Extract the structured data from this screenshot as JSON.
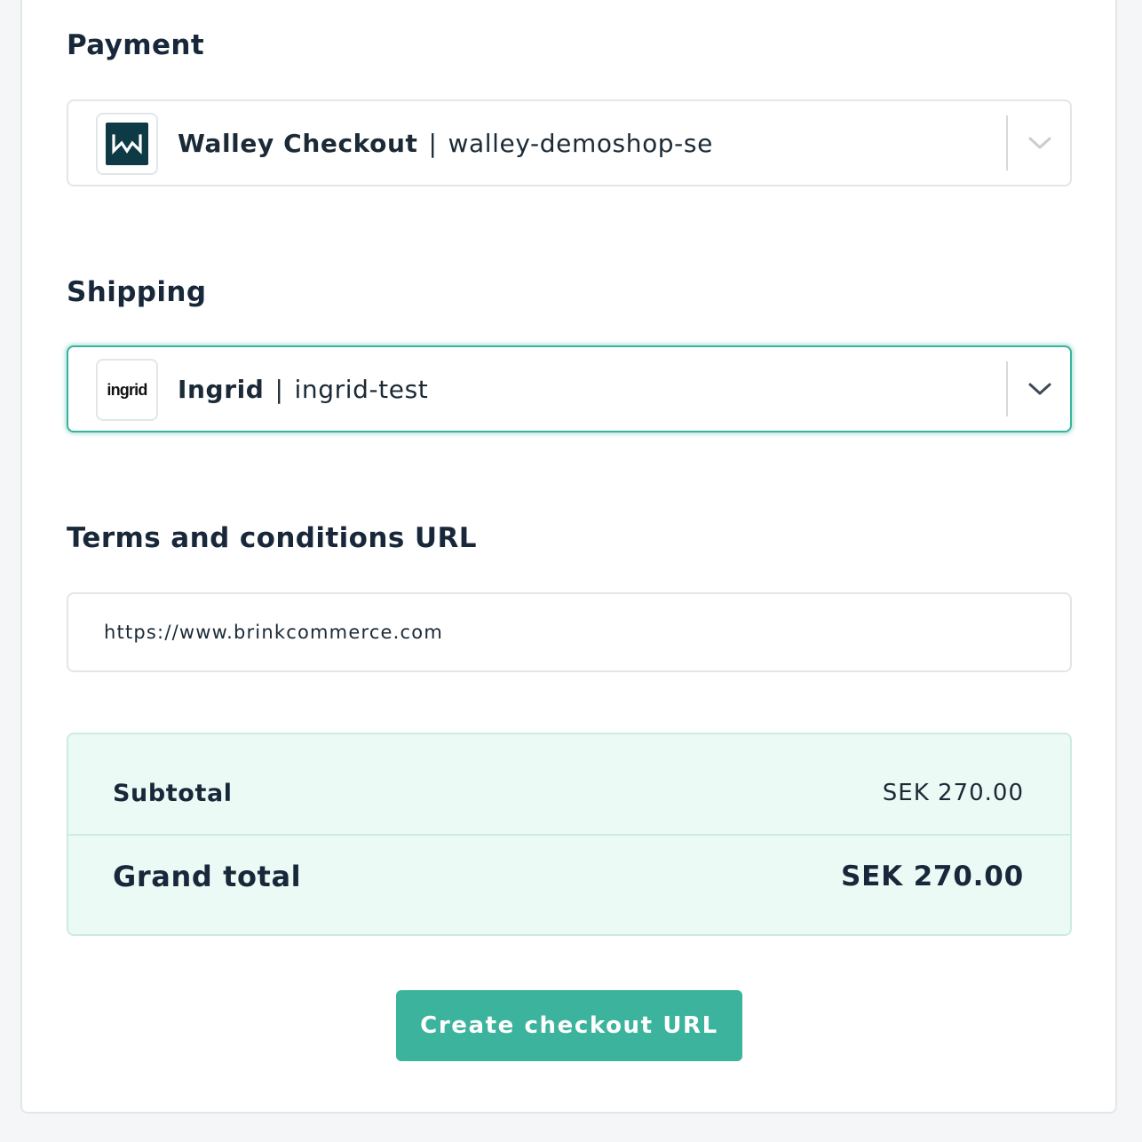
{
  "payment": {
    "section_title": "Payment",
    "selected": {
      "logo_icon": "walley-logo-icon",
      "name": "Walley Checkout",
      "separator": "|",
      "value": "walley-demoshop-se"
    }
  },
  "shipping": {
    "section_title": "Shipping",
    "selected": {
      "logo_text": "ingrid",
      "name": "Ingrid",
      "separator": "|",
      "value": "ingrid-test"
    }
  },
  "terms": {
    "section_title": "Terms and conditions URL",
    "value": "https://www.brinkcommerce.com"
  },
  "totals": {
    "subtotal_label": "Subtotal",
    "subtotal_value": "SEK 270.00",
    "grand_total_label": "Grand total",
    "grand_total_value": "SEK 270.00"
  },
  "actions": {
    "create_button_label": "Create checkout URL"
  },
  "colors": {
    "accent": "#3cb39c",
    "heading": "#18283a",
    "totals_background": "#ecfaf6",
    "walley_brand": "#0e3a45"
  }
}
